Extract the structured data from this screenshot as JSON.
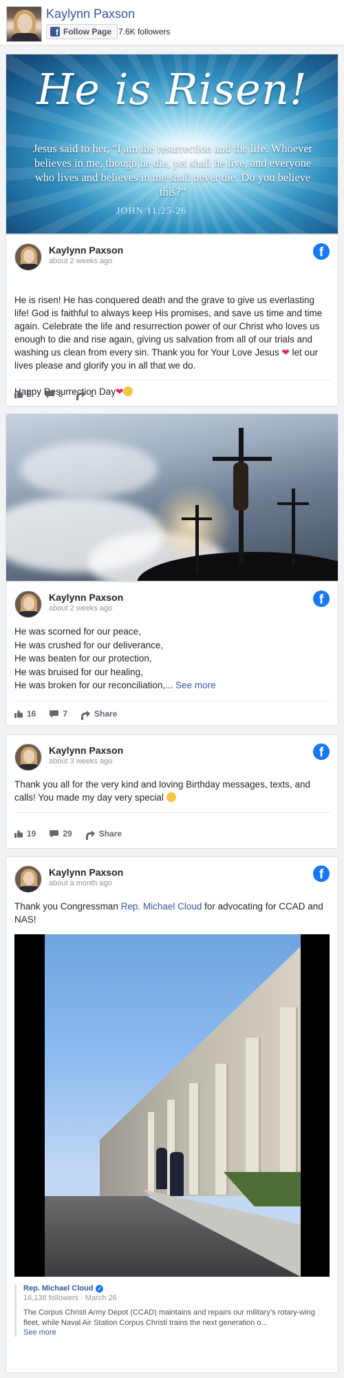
{
  "header": {
    "page_name": "Kaylynn Paxson",
    "follow_label": "Follow Page",
    "followers": "7.6K followers"
  },
  "cover": {
    "title": "He is Risen!",
    "verse": "Jesus said to her, “I am the resurrection and the life. Whoever believes in me, though he die, yet shall he live, and everyone who lives and believes in me shall never die. Do you believe this?”",
    "reference": "JOHN 11:25-26"
  },
  "posts": [
    {
      "author": "Kaylynn Paxson",
      "time": "about 2 weeks ago",
      "text": "He is risen! He has conquered death and the grave to give us everlasting life! God is faithful to always keep His promises, and save us time and time again. Celebrate the life and resurrection power of our Christ who loves us enough to die and rise again, giving us salvation from all of our trials and washing us clean from every sin. Thank you for Your Love Jesus",
      "text2": " let our lives please and glorify you in all that we do.",
      "text3": "Happy Resurrection Day",
      "likes": "8",
      "comments": "8",
      "shares": "1"
    },
    {
      "author": "Kaylynn Paxson",
      "time": "about 2 weeks ago",
      "text": "He was scorned for our peace,\nHe was crushed for our deliverance,\nHe was beaten for our protection,\nHe was bruised for our healing,\nHe was broken for our reconciliation,... ",
      "see_more": "See more",
      "likes": "16",
      "comments": "7",
      "share_label": "Share"
    },
    {
      "author": "Kaylynn Paxson",
      "time": "about 3 weeks ago",
      "text": "Thank you all for the very kind and loving Birthday messages, texts, and calls! You made my day very special",
      "likes": "19",
      "comments": "29",
      "share_label": "Share"
    },
    {
      "author": "Kaylynn Paxson",
      "time": "about a month ago",
      "text_before": "Thank you Congressman ",
      "mention": "Rep. Michael Cloud",
      "text_after": " for advocating for CCAD and NAS!",
      "shared": {
        "name": "Rep. Michael Cloud",
        "followers": "16,138 followers",
        "date": "March 26",
        "text": "The Corpus Christi Army Depot (CCAD) maintains and repairs our military’s rotary-wing fleet, while Naval Air Station Corpus Christi trains the next generation o...",
        "see_more": "See more"
      }
    }
  ],
  "colors": {
    "link": "#365899",
    "facebook_blue": "#1877f2",
    "heart": "#e0245e"
  },
  "icons": {
    "facebook": "facebook-icon",
    "like": "like-icon",
    "comment": "comment-icon",
    "share": "share-icon"
  }
}
